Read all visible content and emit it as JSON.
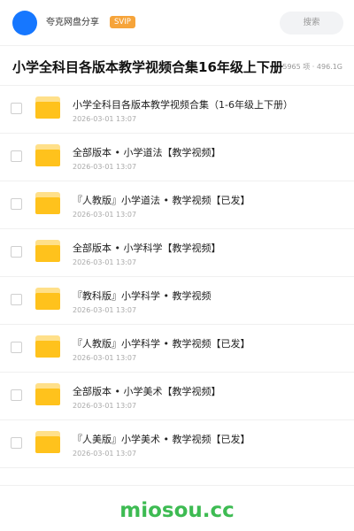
{
  "header": {
    "app_name": "夸克网盘分享",
    "badge": "SVIP",
    "search_label": "搜索"
  },
  "title": "小学全科目各版本教学视频合集16年级上下册",
  "meta": "5965 项 · 496.1G",
  "files": [
    {
      "name": "小学全科目各版本教学视频合集（1-6年级上下册）",
      "date": "2026-03-01 13:07"
    },
    {
      "name": "全部版本 • 小学道法【教学视频】",
      "date": "2026-03-01 13:07"
    },
    {
      "name": "『人教版』小学道法 • 教学视频【已发】",
      "date": "2026-03-01 13:07"
    },
    {
      "name": "全部版本 • 小学科学【教学视频】",
      "date": "2026-03-01 13:07"
    },
    {
      "name": "『教科版』小学科学 • 教学视频",
      "date": "2026-03-01 13:07"
    },
    {
      "name": "『人教版』小学科学 • 教学视频【已发】",
      "date": "2026-03-01 13:07"
    },
    {
      "name": "全部版本 • 小学美术【教学视频】",
      "date": "2026-03-01 13:07"
    },
    {
      "name": "『人美版』小学美术 • 教学视频【已发】",
      "date": "2026-03-01 13:07"
    }
  ],
  "footer": {
    "brand": "miosou.cc"
  },
  "colors": {
    "avatar": "#1677ff",
    "badge": "#f6a43a",
    "folder": "#ffc21c",
    "brand": "#3dbb52"
  },
  "icons": {
    "folder": "folder-icon",
    "avatar": "avatar"
  }
}
